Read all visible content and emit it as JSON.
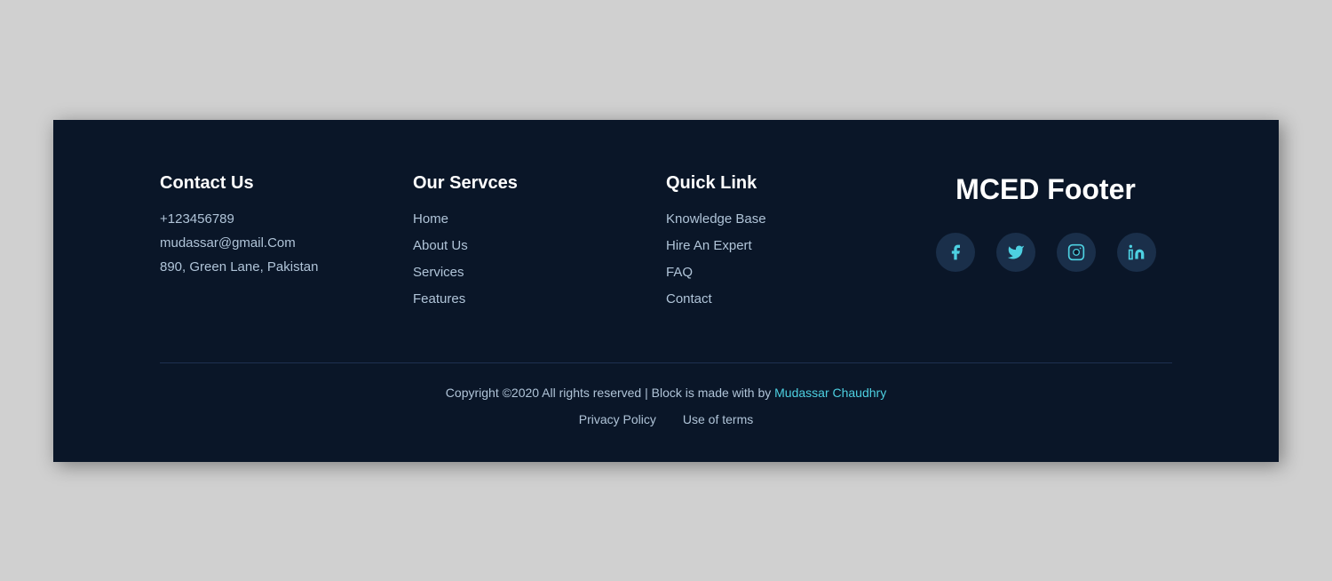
{
  "footer": {
    "contact": {
      "heading": "Contact Us",
      "phone": "+123456789",
      "email": "mudassar@gmail.Com",
      "address": "890, Green Lane, Pakistan"
    },
    "services": {
      "heading": "Our Servces",
      "links": [
        {
          "label": "Home",
          "href": "#"
        },
        {
          "label": "About Us",
          "href": "#"
        },
        {
          "label": "Services",
          "href": "#"
        },
        {
          "label": "Features",
          "href": "#"
        }
      ]
    },
    "quicklinks": {
      "heading": "Quick Link",
      "links": [
        {
          "label": "Knowledge Base",
          "href": "#"
        },
        {
          "label": "Hire An Expert",
          "href": "#"
        },
        {
          "label": "FAQ",
          "href": "#"
        },
        {
          "label": "Contact",
          "href": "#"
        }
      ]
    },
    "brand": {
      "title": "MCED Footer",
      "social": [
        {
          "name": "facebook",
          "label": "Facebook"
        },
        {
          "name": "twitter",
          "label": "Twitter"
        },
        {
          "name": "instagram",
          "label": "Instagram"
        },
        {
          "name": "linkedin",
          "label": "LinkedIn"
        }
      ]
    },
    "bottom": {
      "copyright": "Copyright ©2020 All rights reserved | Block is made with by",
      "author": "Mudassar Chaudhry",
      "privacy_policy": "Privacy Policy",
      "use_of_terms": "Use of terms"
    }
  }
}
